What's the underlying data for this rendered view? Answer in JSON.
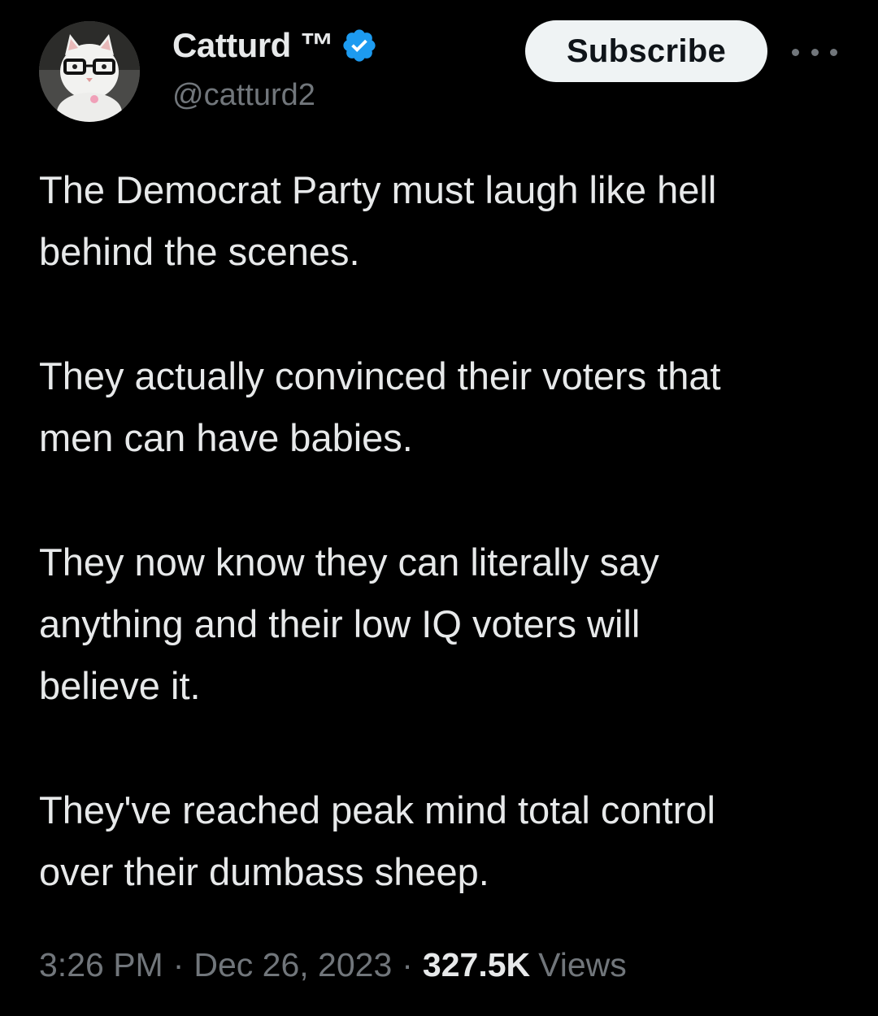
{
  "author": {
    "display_name": "Catturd ™",
    "handle": "@catturd2",
    "verified_icon": "verified-badge-icon",
    "avatar_icon": "avatar-cat-with-glasses"
  },
  "actions": {
    "subscribe_label": "Subscribe",
    "more_icon": "more-options-icon"
  },
  "tweet": {
    "paragraphs": [
      "The Democrat Party must laugh like hell\nbehind the scenes.",
      "They actually convinced their voters that\nmen can have babies.",
      "They now know they can literally say\nanything and their low IQ voters will\nbelieve it.",
      "They've reached peak mind total control\nover their dumbass sheep."
    ]
  },
  "meta": {
    "time": "3:26 PM",
    "separator": "·",
    "date": "Dec 26, 2023",
    "views_count": "327.5K",
    "views_label": "Views"
  },
  "colors": {
    "background": "#000000",
    "text_primary": "#e7e9ea",
    "text_secondary": "#71767b",
    "verified_blue": "#1d9bf0",
    "button_bg": "#eff3f4"
  }
}
